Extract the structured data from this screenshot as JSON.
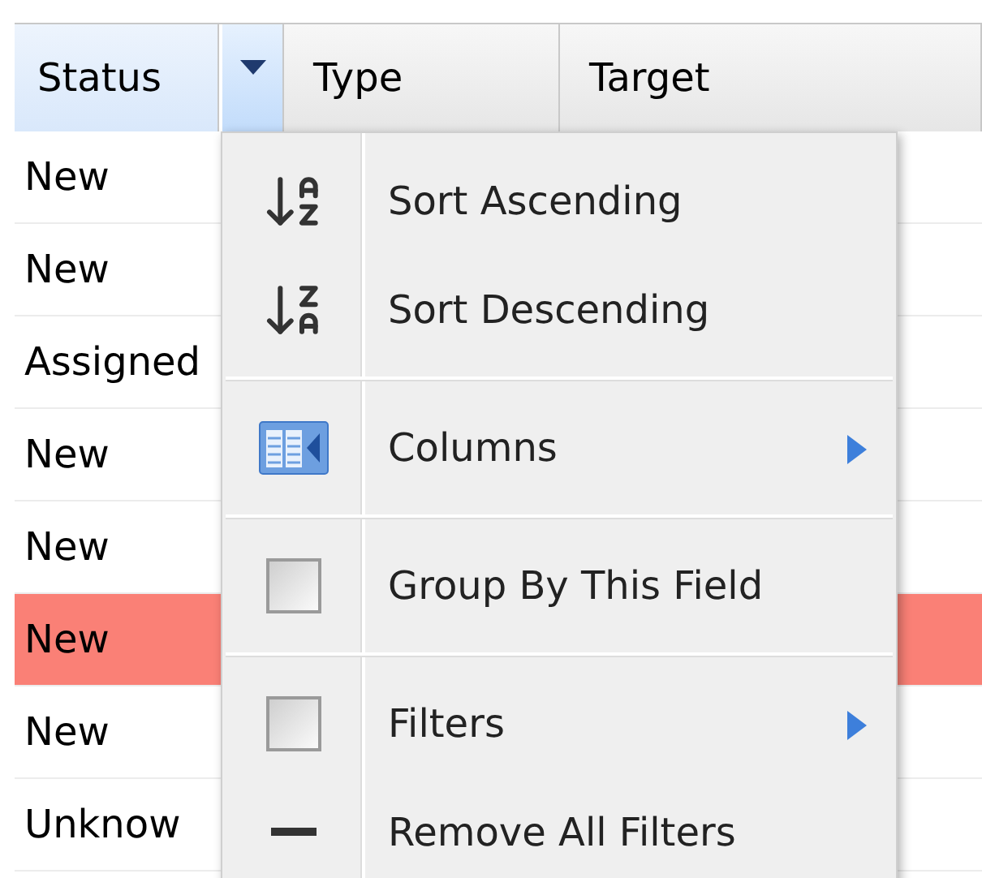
{
  "columns": [
    {
      "label": "Status",
      "selected": true
    },
    {
      "label": "Type",
      "selected": false
    },
    {
      "label": "Target",
      "selected": false
    }
  ],
  "rows": [
    {
      "status": "New",
      "highlighted": false
    },
    {
      "status": "New",
      "highlighted": false
    },
    {
      "status": "Assigned",
      "highlighted": false
    },
    {
      "status": "New",
      "highlighted": false
    },
    {
      "status": "New",
      "highlighted": false
    },
    {
      "status": "New",
      "highlighted": true
    },
    {
      "status": "New",
      "highlighted": false
    },
    {
      "status": "Unknow",
      "highlighted": false
    }
  ],
  "column_menu": {
    "groups": [
      [
        {
          "kind": "sort-asc",
          "label": "Sort Ascending",
          "submenu": false
        },
        {
          "kind": "sort-desc",
          "label": "Sort Descending",
          "submenu": false
        }
      ],
      [
        {
          "kind": "columns",
          "label": "Columns",
          "submenu": true
        }
      ],
      [
        {
          "kind": "checkbox",
          "label": "Group By This Field",
          "checked": false,
          "submenu": false
        }
      ],
      [
        {
          "kind": "checkbox",
          "label": "Filters",
          "checked": false,
          "submenu": true
        },
        {
          "kind": "dash",
          "label": "Remove All Filters",
          "submenu": false
        }
      ]
    ]
  }
}
